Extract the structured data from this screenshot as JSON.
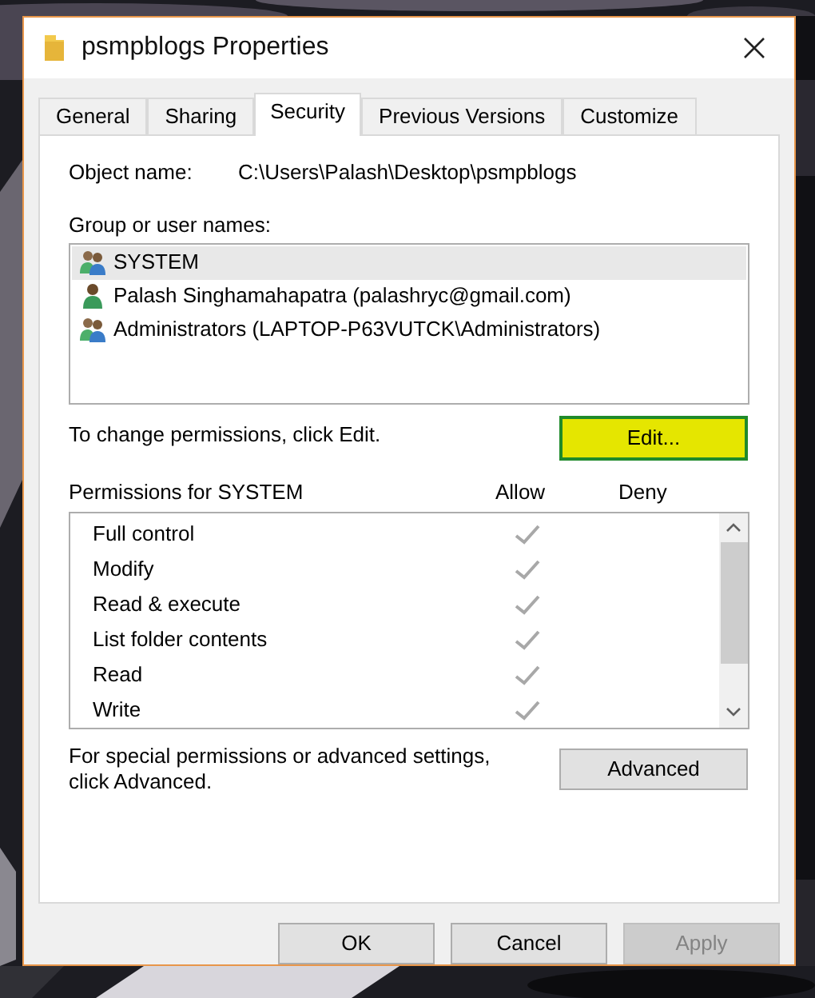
{
  "window": {
    "title": "psmpblogs Properties"
  },
  "tabs": [
    {
      "label": "General",
      "selected": false
    },
    {
      "label": "Sharing",
      "selected": false
    },
    {
      "label": "Security",
      "selected": true
    },
    {
      "label": "Previous Versions",
      "selected": false
    },
    {
      "label": "Customize",
      "selected": false
    }
  ],
  "object_name": {
    "label": "Object name:",
    "value": "C:\\Users\\Palash\\Desktop\\psmpblogs"
  },
  "users": {
    "label": "Group or user names:",
    "items": [
      {
        "name": "SYSTEM",
        "kind": "group",
        "selected": true
      },
      {
        "name": "Palash Singhamahapatra (palashryc@gmail.com)",
        "kind": "user",
        "selected": false
      },
      {
        "name": "Administrators (LAPTOP-P63VUTCK\\Administrators)",
        "kind": "group",
        "selected": false
      }
    ]
  },
  "change_hint": "To change permissions, click Edit.",
  "edit_button": {
    "label": "Edit...",
    "highlighted": true
  },
  "permissions": {
    "label": "Permissions for SYSTEM",
    "columns": [
      "Allow",
      "Deny"
    ],
    "rows": [
      {
        "name": "Full control",
        "allow": true,
        "deny": false
      },
      {
        "name": "Modify",
        "allow": true,
        "deny": false
      },
      {
        "name": "Read & execute",
        "allow": true,
        "deny": false
      },
      {
        "name": "List folder contents",
        "allow": true,
        "deny": false
      },
      {
        "name": "Read",
        "allow": true,
        "deny": false
      },
      {
        "name": "Write",
        "allow": true,
        "deny": false
      }
    ]
  },
  "advanced_hint": "For special permissions or advanced settings, click Advanced.",
  "advanced_button": {
    "label": "Advanced"
  },
  "buttons": [
    {
      "label": "OK",
      "disabled": false
    },
    {
      "label": "Cancel",
      "disabled": false
    },
    {
      "label": "Apply",
      "disabled": true
    }
  ]
}
